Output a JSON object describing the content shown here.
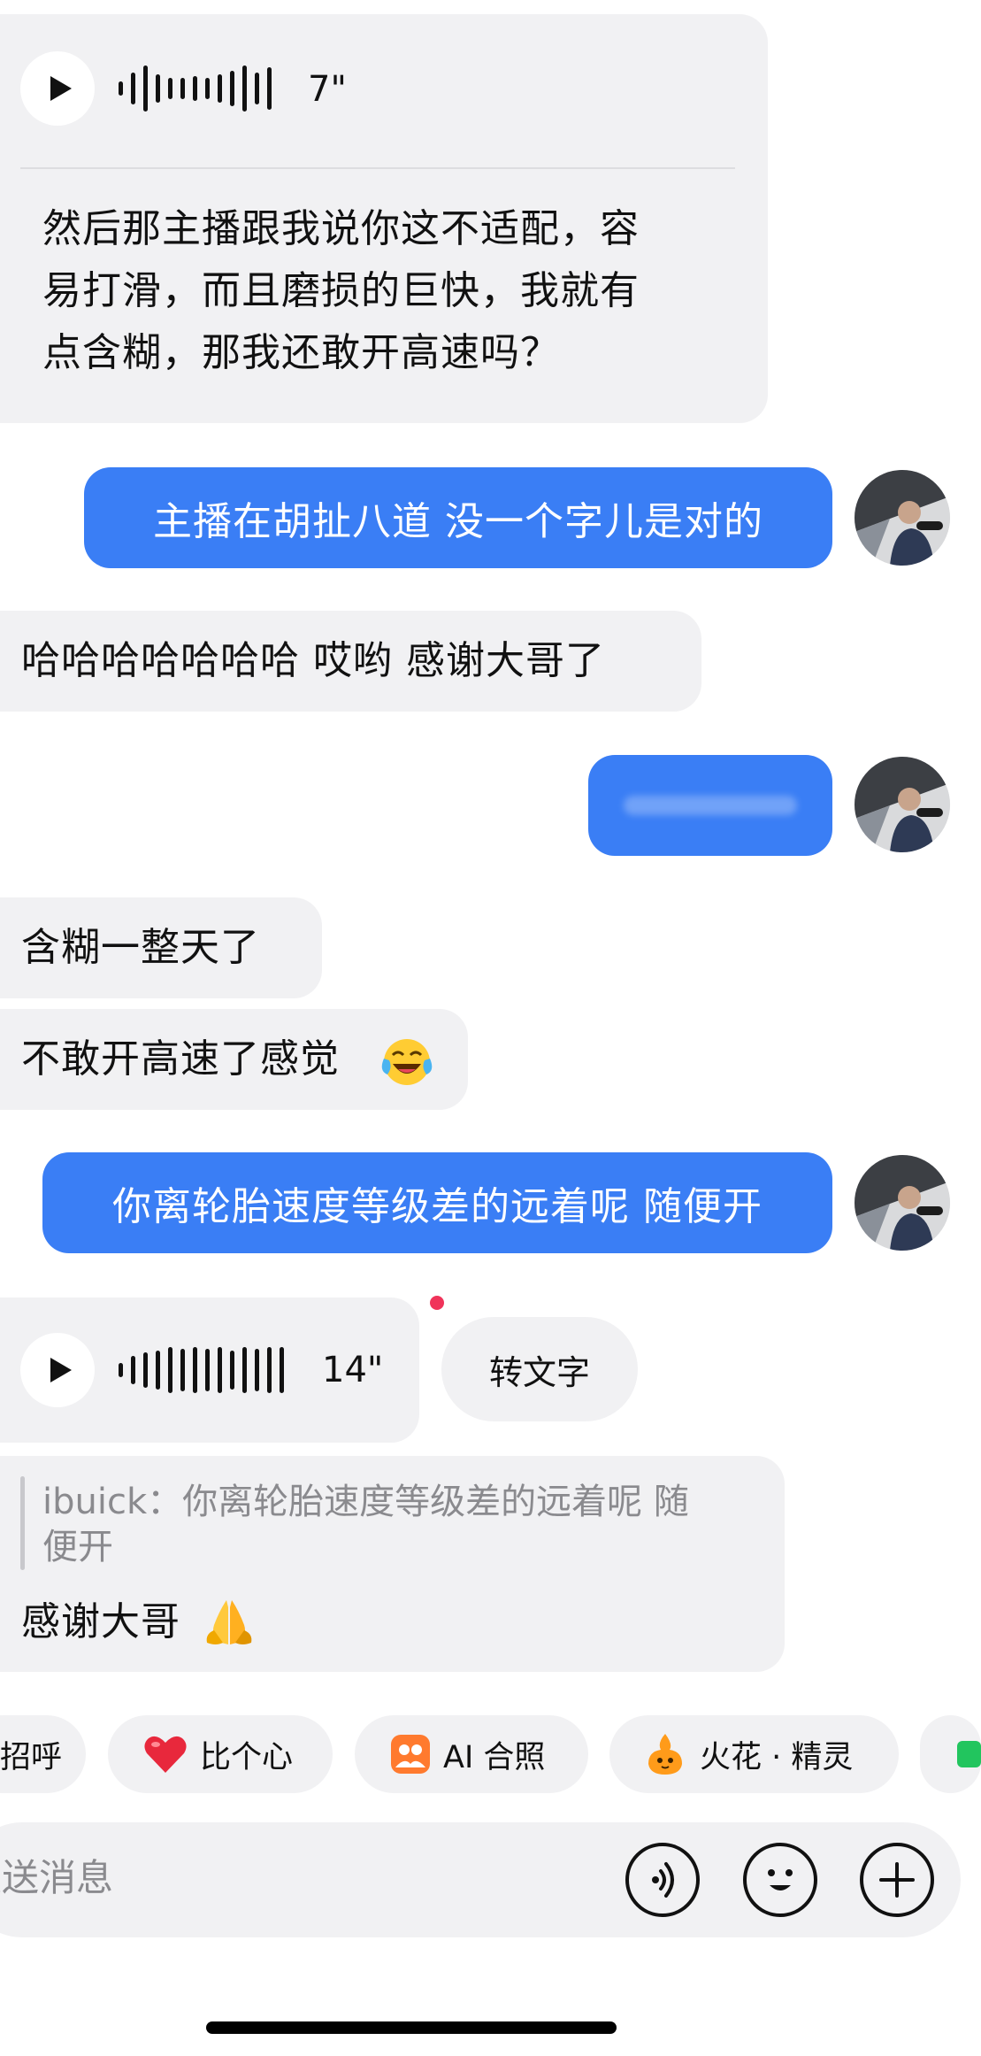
{
  "messages": {
    "voice1": {
      "duration": "7\"",
      "transcript": [
        "然后那主播跟我说你这不适配，容",
        "易打滑，而且磨损的巨快，我就有",
        "点含糊，那我还敢开高速吗？"
      ]
    },
    "out1": "主播在胡扯八道 没一个字儿是对的",
    "in1": "哈哈哈哈哈哈哈 哎哟 感谢大哥了",
    "out2_blurred": "",
    "in2": "含糊一整天了",
    "in3": "不敢开高速了感觉",
    "in3_emoji": "😂",
    "out3": "你离轮胎速度等级差的远着呢 随便开",
    "voice2": {
      "duration": "14\"",
      "transcribe_button": "转文字"
    },
    "reply": {
      "quote_line1": "ibuick：你离轮胎速度等级差的远着呢 随",
      "quote_line2": "便开",
      "text": "感谢大哥",
      "emoji": "🙏"
    }
  },
  "quick_actions": [
    {
      "label": "招呼",
      "icon": ""
    },
    {
      "label": "比个心",
      "icon": "heart-icon"
    },
    {
      "label": "AI 合照",
      "icon": "ai-photo-icon"
    },
    {
      "label": "火花 · 精灵",
      "icon": "spark-sprite-icon"
    }
  ],
  "composer": {
    "placeholder": "发送消息",
    "buttons": [
      "voice-icon",
      "emoji-face-icon",
      "plus-icon"
    ]
  },
  "colors": {
    "outgoing_bubble": "#3a7ef5",
    "incoming_bubble": "#f1f1f3",
    "unread_dot": "#f0335a",
    "heart": "#e8283c",
    "ai_photo": "#ff7a2e",
    "sprite": "#ff9b1a",
    "green_chip": "#22c55e"
  }
}
